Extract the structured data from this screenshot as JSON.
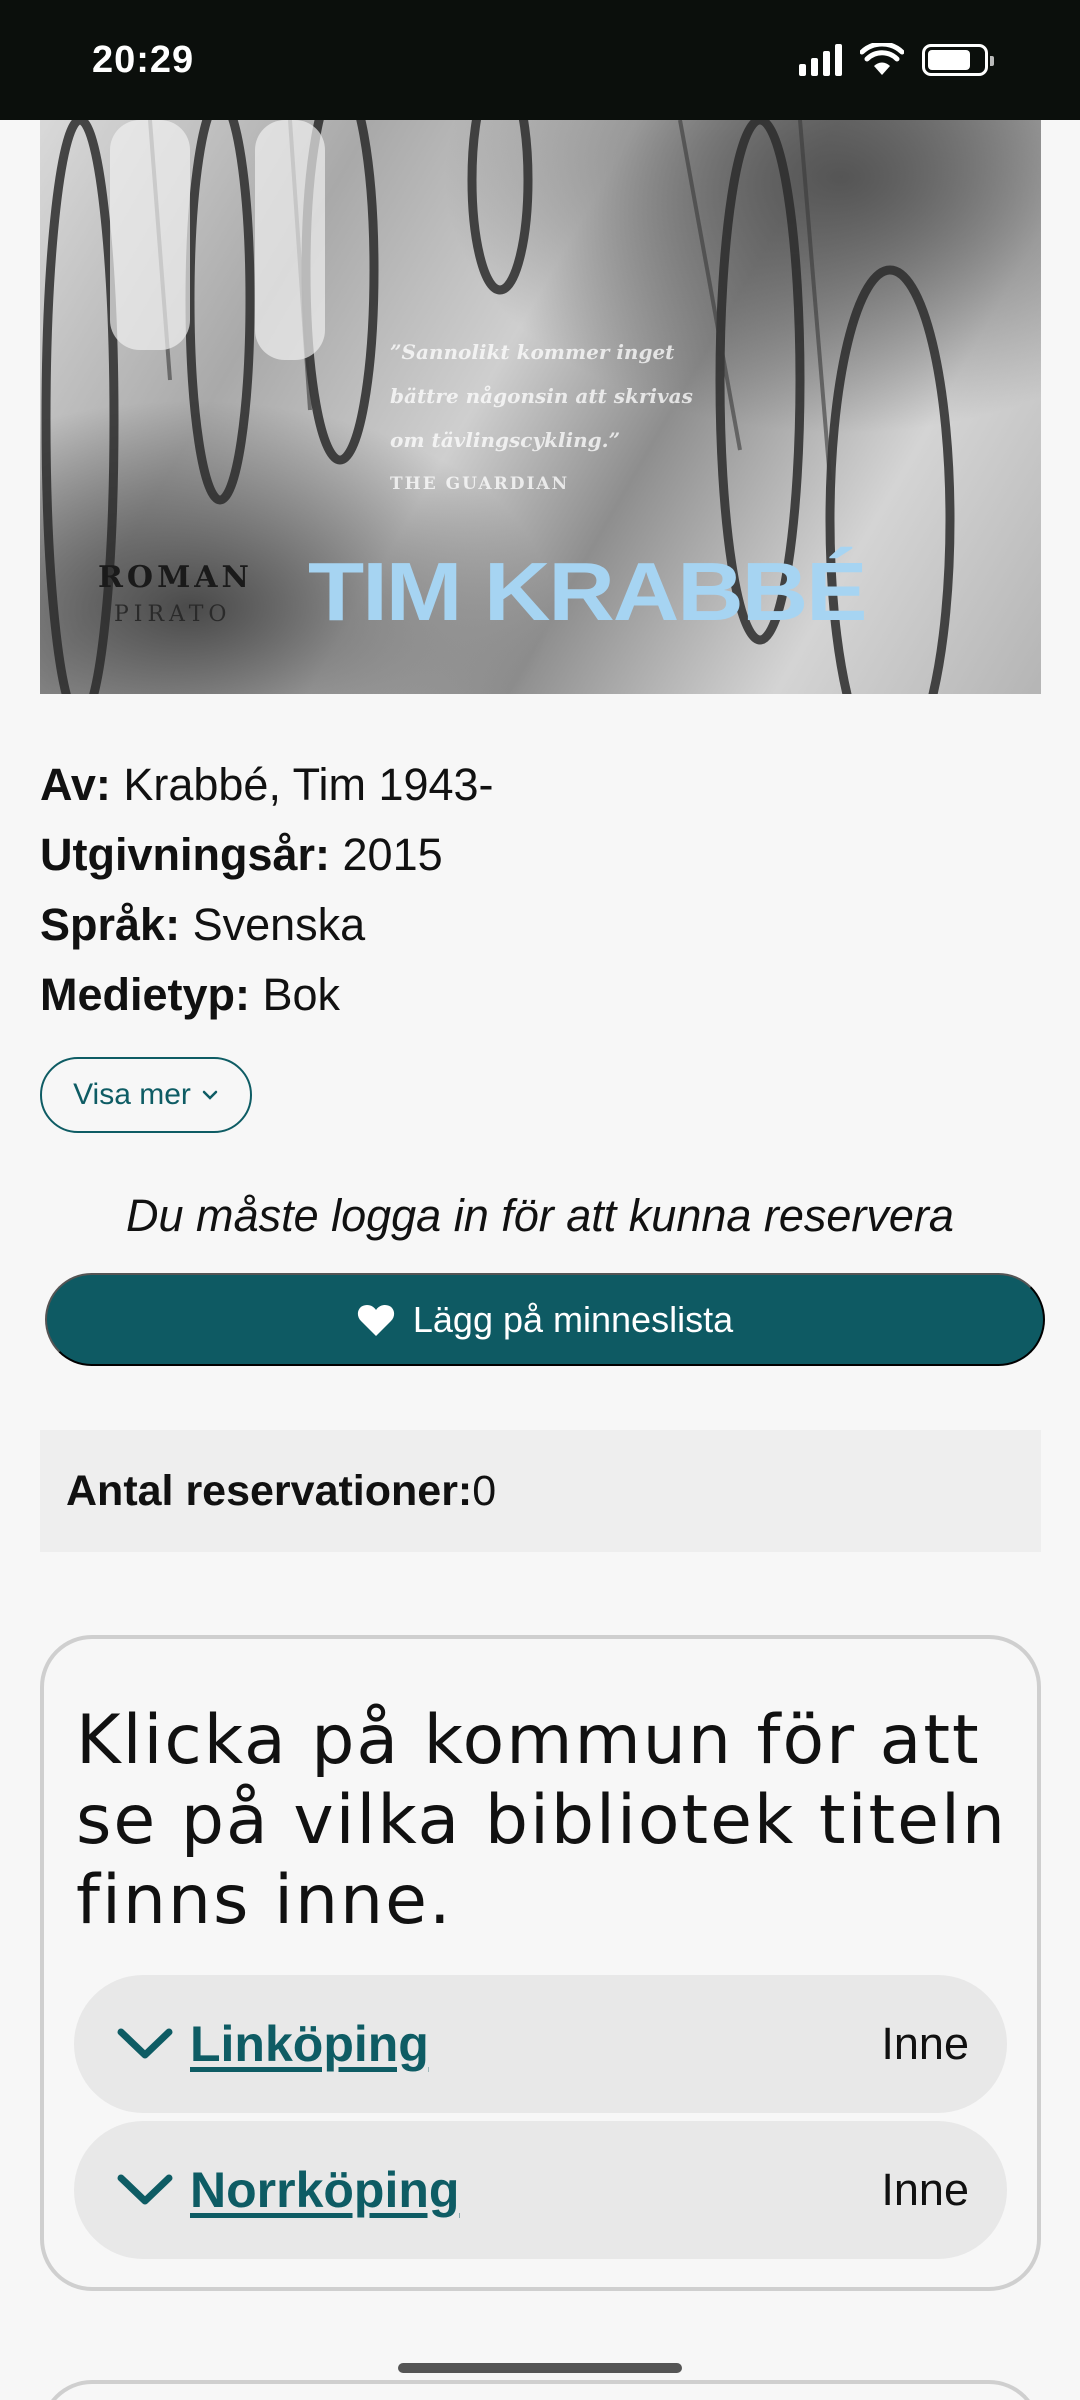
{
  "status_bar": {
    "time": "20:29"
  },
  "cover": {
    "quote_lines": [
      "”Sannolikt kommer inget",
      "bättre någonsin att skrivas",
      "om tävlingscykling.”"
    ],
    "quote_source": "THE GUARDIAN",
    "genre": "ROMAN",
    "publisher": "PIRATO",
    "author": "TIM KRABBÉ"
  },
  "metadata": [
    {
      "key": "Av:",
      "value": " Krabbé, Tim 1943-"
    },
    {
      "key": "Utgivningsår:",
      "value": " 2015"
    },
    {
      "key": "Språk:",
      "value": " Svenska"
    },
    {
      "key": "Medietyp:",
      "value": " Bok"
    }
  ],
  "show_more_label": "Visa mer",
  "login_note": "Du måste logga in för att kunna reservera",
  "wishlist_label": "Lägg på minneslista",
  "reservations": {
    "key": "Antal reservationer:",
    "value": " 0"
  },
  "libraries": {
    "heading": "Klicka på kommun för att se på vilka bibliotek titeln finns inne.",
    "municipalities": [
      {
        "name": "Linköping",
        "status": "Inne"
      },
      {
        "name": "Norrköping",
        "status": "Inne"
      }
    ]
  },
  "colors": {
    "accent": "#0e5a63",
    "status_bar": "#0b0f0c",
    "panel": "#eeeeee"
  }
}
